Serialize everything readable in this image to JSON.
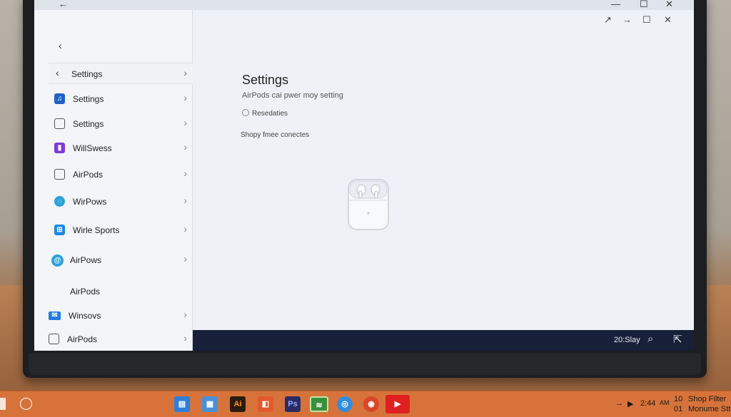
{
  "window": {
    "back_glyph": "←",
    "controls": [
      "—",
      "☐",
      "✕"
    ],
    "inner_controls": [
      "↗",
      "→",
      "☐",
      "✕"
    ]
  },
  "sidebar": {
    "nav_back_glyph": "‹",
    "header": {
      "label": "Settings"
    },
    "items": [
      {
        "label": "Settings",
        "icon": "music-icon",
        "color": "#1f63c9",
        "chevron": true
      },
      {
        "label": "Settings",
        "icon": "folder-icon",
        "color": "#555555",
        "chevron": true
      },
      {
        "label": "WillSwess",
        "icon": "media-icon",
        "color": "#7c3bd6",
        "chevron": true
      },
      {
        "label": "AirPods",
        "icon": "monitor-icon",
        "color": "#555555",
        "chevron": true
      },
      {
        "label": "WirPows",
        "icon": "globe-icon",
        "color": "#2aa3d9",
        "chevron": true
      },
      {
        "label": "Wirle Sports",
        "icon": "windows-icon",
        "color": "#1e88e5",
        "chevron": true
      },
      {
        "label": "AirPows",
        "icon": "at-icon",
        "color": "#2aa3d9",
        "chevron": true
      },
      {
        "label": "AirPods",
        "icon": "",
        "color": "",
        "chevron": false
      },
      {
        "label": "Winsovs",
        "icon": "mail-icon",
        "color": "#1e7be0",
        "chevron": true
      },
      {
        "label": "AirPods",
        "icon": "grid-icon",
        "color": "#555555",
        "chevron": true
      }
    ]
  },
  "main": {
    "title": "Settings",
    "subtitle": "AirPods cai pwer moy setting",
    "link": "Resedaties",
    "note": "Shopy fmee conectes",
    "image": "airpods-case-icon"
  },
  "app_strip": {
    "time_label": "20:Slay",
    "icons": [
      "search-icon",
      "share-icon"
    ]
  },
  "taskbar": {
    "apps": [
      {
        "name": "file-explorer-icon",
        "label": "▤",
        "color": "#2f7fd8"
      },
      {
        "name": "photos-icon",
        "label": "▦",
        "color": "#4a90d9"
      },
      {
        "name": "illustrator-icon",
        "label": "Ai",
        "color": "#2b1a0f"
      },
      {
        "name": "office-icon",
        "label": "◧",
        "color": "#e05a2b"
      },
      {
        "name": "photoshop-icon",
        "label": "Ps",
        "color": "#2a2d63"
      },
      {
        "name": "spotify-icon",
        "label": "≋",
        "color": "#3a8f3a"
      },
      {
        "name": "safari-icon",
        "label": "◎",
        "color": "#2e8de0"
      },
      {
        "name": "chrome-icon",
        "label": "◉",
        "color": "#d9452b"
      },
      {
        "name": "youtube-icon",
        "label": "▶",
        "color": "#e02020"
      }
    ],
    "tray": {
      "arrow": "→",
      "play": "▶",
      "time": "2:44",
      "am": "AM",
      "line1_num": "10",
      "line1_text": "Shop Filter",
      "line2_num": "01",
      "line2_text": "Monume Stt"
    }
  }
}
